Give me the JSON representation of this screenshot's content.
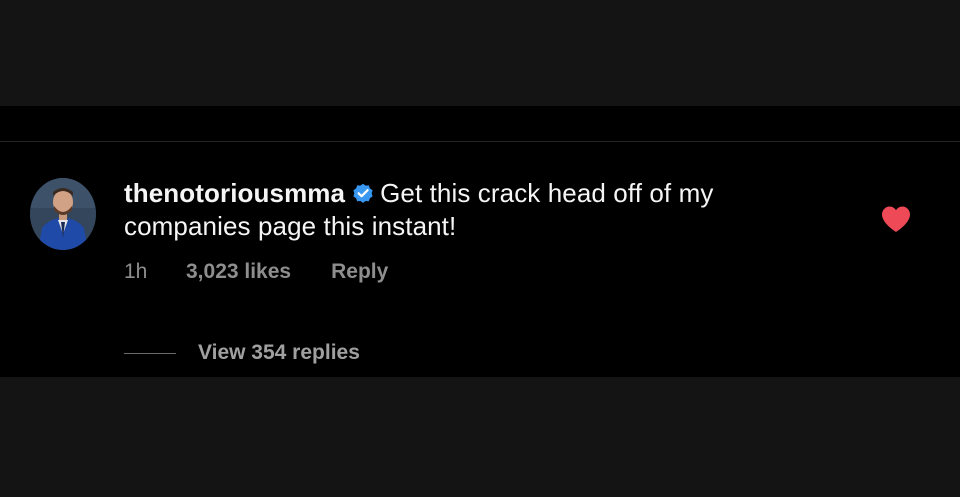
{
  "comment": {
    "username": "thenotoriousmma",
    "verified": true,
    "text": "Get this crack head off of my companies page this instant!",
    "time": "1h",
    "likes": "3,023 likes",
    "reply_label": "Reply",
    "liked": true,
    "view_replies_label": "View 354 replies"
  },
  "icons": {
    "verified": "verified-badge-icon",
    "like": "heart-icon"
  },
  "colors": {
    "background_outer": "#141414",
    "background_panel": "#000000",
    "text_primary": "#f5f5f5",
    "text_secondary": "#8e8e8e",
    "verified_blue": "#3897f0",
    "heart_red": "#ed4956"
  }
}
